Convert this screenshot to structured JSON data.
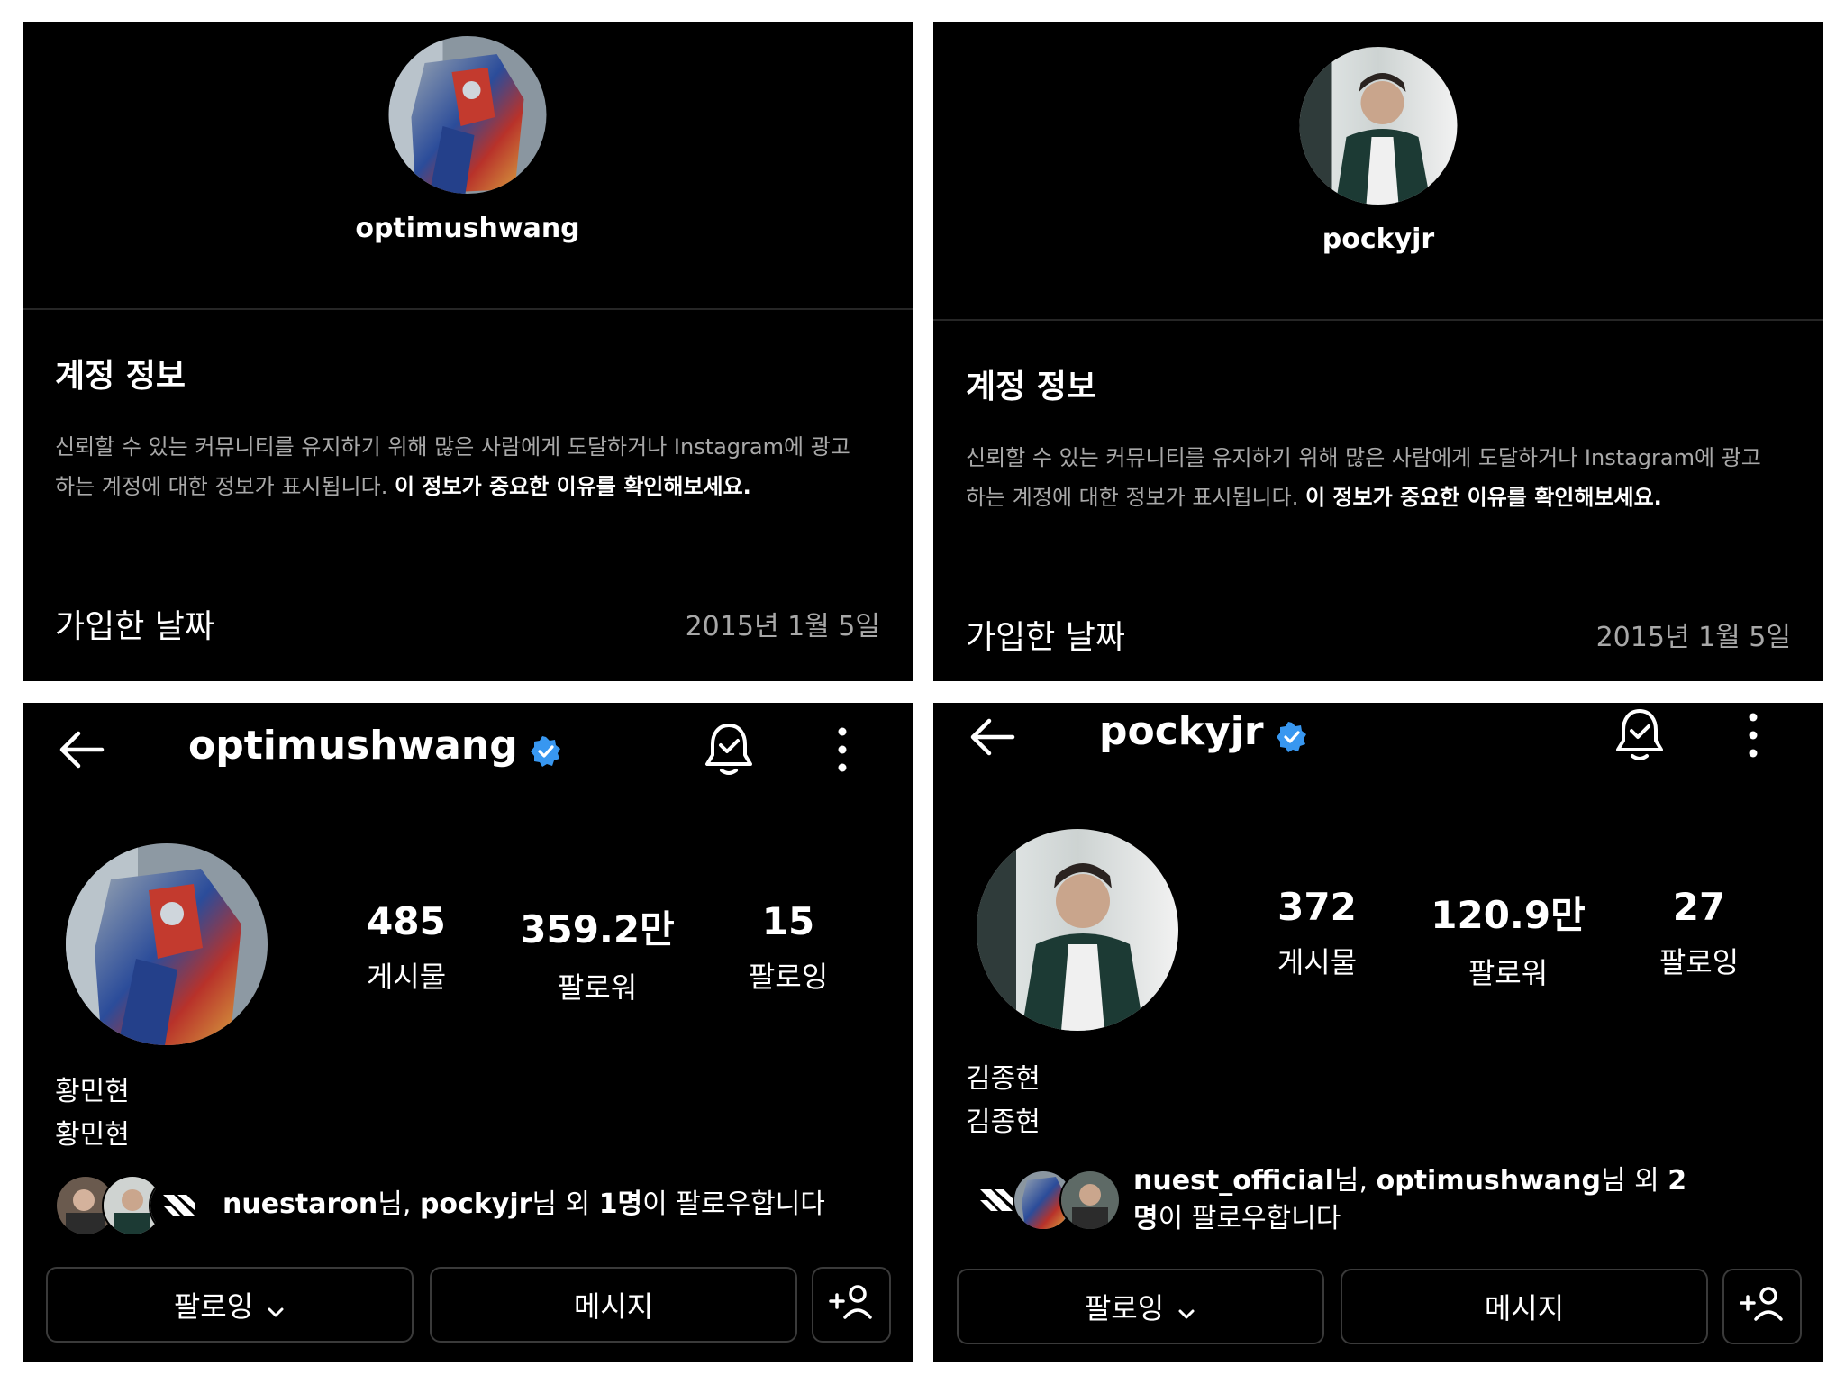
{
  "left": {
    "account_info": {
      "username": "optimushwang",
      "section_title": "계정 정보",
      "description": "신뢰할 수 있는 커뮤니티를 유지하기 위해 많은 사람에게 도달하거나 Instagram에 광고하는 계정에 대한 정보가 표시됩니다.",
      "learn_more": "이 정보가 중요한 이유를 확인해보세요.",
      "joined_label": "가입한 날짜",
      "joined_value": "2015년 1월 5일"
    },
    "profile": {
      "username": "optimushwang",
      "stats": [
        {
          "value": "485",
          "label": "게시물"
        },
        {
          "value": "359.2만",
          "label": "팔로워"
        },
        {
          "value": "15",
          "label": "팔로잉"
        }
      ],
      "name_line1": "황민현",
      "name_line2": "황민현",
      "mutual": {
        "user1": "nuestaron",
        "sep1": "님, ",
        "user2": "pockyjr",
        "mid": "님 외 ",
        "count": "1명",
        "tail": "이 팔로우합니다"
      },
      "buttons": {
        "following": "팔로잉",
        "message": "메시지"
      }
    }
  },
  "right": {
    "account_info": {
      "username": "pockyjr",
      "section_title": "계정 정보",
      "description": "신뢰할 수 있는 커뮤니티를 유지하기 위해 많은 사람에게 도달하거나 Instagram에 광고하는 계정에 대한 정보가 표시됩니다.",
      "learn_more": "이 정보가 중요한 이유를 확인해보세요.",
      "joined_label": "가입한 날짜",
      "joined_value": "2015년 1월 5일"
    },
    "profile": {
      "username": "pockyjr",
      "stats": [
        {
          "value": "372",
          "label": "게시물"
        },
        {
          "value": "120.9만",
          "label": "팔로워"
        },
        {
          "value": "27",
          "label": "팔로잉"
        }
      ],
      "name_line1": "김종현",
      "name_line2": "김종현",
      "mutual": {
        "user1": "nuest_official",
        "sep1": "님, ",
        "user2": "optimushwang",
        "mid": "님 외 ",
        "count": "2명",
        "tail": "이 팔로우합니다"
      },
      "buttons": {
        "following": "팔로잉",
        "message": "메시지"
      }
    }
  },
  "colors": {
    "background": "#000000",
    "verified": "#3897f0",
    "muted_text": "#a8a8a8",
    "border": "#3a3a3a"
  },
  "icons": [
    "back-arrow-icon",
    "verified-badge-icon",
    "notification-bell-icon",
    "more-options-icon",
    "chevron-down-icon",
    "add-person-icon"
  ]
}
